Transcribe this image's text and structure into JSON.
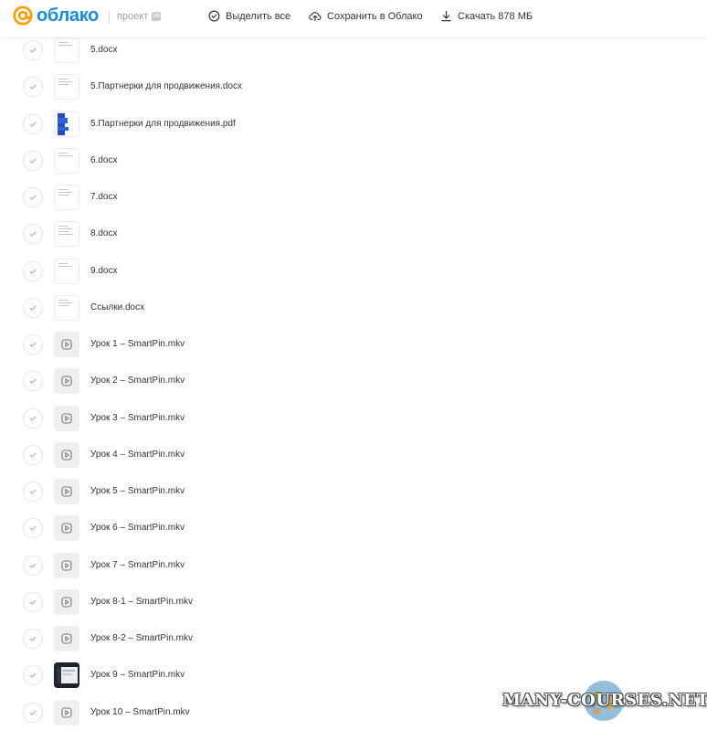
{
  "header": {
    "logo_text": "облако",
    "project_label": "проект",
    "vk_badge": "VK",
    "select_all": "Выделить все",
    "save_to_cloud": "Сохранить в Облако",
    "download": "Скачать 878 МБ"
  },
  "files": [
    {
      "name": "5.docx",
      "type": "doc"
    },
    {
      "name": "5.Партнерки для продвижения.docx",
      "type": "doc"
    },
    {
      "name": "5.Партнерки для продвижения.pdf",
      "type": "pdf"
    },
    {
      "name": "6.docx",
      "type": "doc"
    },
    {
      "name": "7.docx",
      "type": "doc"
    },
    {
      "name": "8.docx",
      "type": "doc"
    },
    {
      "name": "9.docx",
      "type": "doc"
    },
    {
      "name": "Ссылки.docx",
      "type": "doc"
    },
    {
      "name": "Урок 1 – SmartPin.mkv",
      "type": "video"
    },
    {
      "name": "Урок 2 – SmartPin.mkv",
      "type": "video"
    },
    {
      "name": "Урок 3 – SmartPin.mkv",
      "type": "video"
    },
    {
      "name": "Урок 4 – SmartPin.mkv",
      "type": "video"
    },
    {
      "name": "Урок 5 – SmartPin.mkv",
      "type": "video"
    },
    {
      "name": "Урок 6 – SmartPin.mkv",
      "type": "video"
    },
    {
      "name": "Урок 7 – SmartPin.mkv",
      "type": "video"
    },
    {
      "name": "Урок 8-1 – SmartPin.mkv",
      "type": "video"
    },
    {
      "name": "Урок 8-2 – SmartPin.mkv",
      "type": "video"
    },
    {
      "name": "Урок 9 – SmartPin.mkv",
      "type": "image"
    },
    {
      "name": "Урок 10 – SmartPin.mkv",
      "type": "video"
    }
  ],
  "watermark": "MANY-COURSES.NET",
  "colors": {
    "brand": "#168de2",
    "logo_orange": "#ff9e00"
  }
}
